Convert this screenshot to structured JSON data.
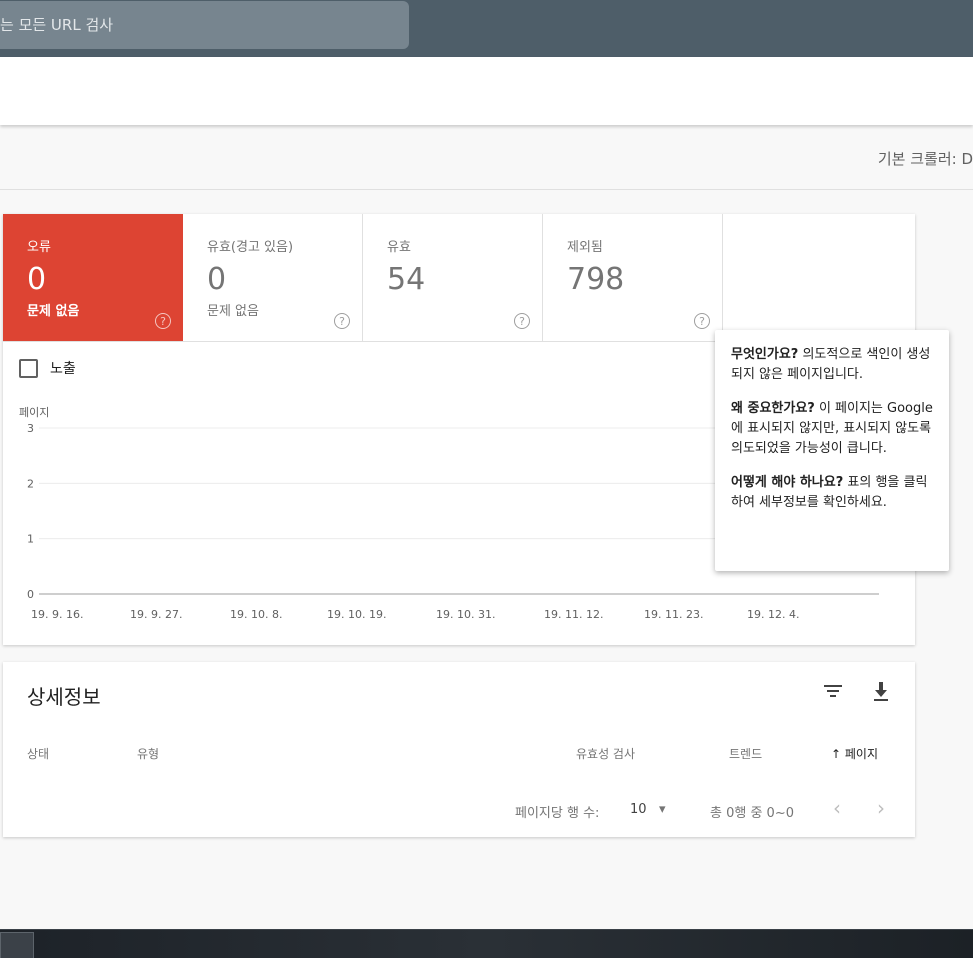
{
  "search": {
    "placeholder": "는 모든 URL 검사"
  },
  "crawler_label": "기본 크롤러: D",
  "tiles": [
    {
      "label": "오류",
      "value": "0",
      "sub": "문제 없음"
    },
    {
      "label": "유효(경고 있음)",
      "value": "0",
      "sub": "문제 없음"
    },
    {
      "label": "유효",
      "value": "54",
      "sub": ""
    },
    {
      "label": "제외됨",
      "value": "798",
      "sub": ""
    }
  ],
  "help_glyph": "?",
  "colors": {
    "error_tile": "#dd4433",
    "topbar": "#4e5e69"
  },
  "impressions_label": "노출",
  "chart_data": {
    "type": "line",
    "ylabel": "페이지",
    "ylim": [
      0,
      3
    ],
    "yticks": [
      "0",
      "1",
      "2",
      "3"
    ],
    "xticks": [
      "19. 9. 16.",
      "19. 9. 27.",
      "19. 10. 8.",
      "19. 10. 19.",
      "19. 10. 31.",
      "19. 11. 12.",
      "19. 11. 23.",
      "19. 12. 4."
    ],
    "series": [],
    "grid": true
  },
  "tooltip": {
    "q1": "무엇인가요?",
    "a1": " 의도적으로 색인이 생성되지 않은 페이지입니다.",
    "q2": "왜 중요한가요?",
    "a2": " 이 페이지는 Google에 표시되지 않지만, 표시되지 않도록 의도되었을 가능성이 큽니다.",
    "q3": "어떻게 해야 하나요?",
    "a3": " 표의 행을 클릭하여 세부정보를 확인하세요."
  },
  "details": {
    "title": "상세정보",
    "columns": {
      "status": "상태",
      "type": "유형",
      "validation": "유효성 검사",
      "trend": "트렌드",
      "pages": "↑ 페이지"
    },
    "pagination": {
      "rows_label": "페이지당 행 수:",
      "rows_value": "10",
      "range": "총 0행 중 0~0"
    }
  },
  "icons": {
    "filter": "filter-icon",
    "download": "download-icon",
    "prev": "‹",
    "next": "›",
    "dropdown": "▾"
  }
}
